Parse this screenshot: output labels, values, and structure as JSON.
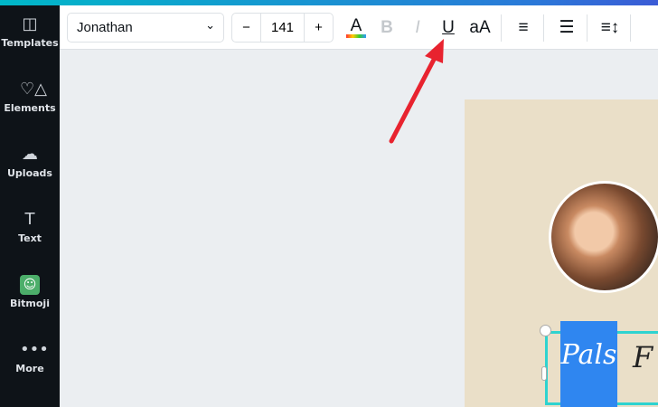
{
  "sidebar": {
    "items": [
      {
        "label": "Templates",
        "icon": "templates-icon"
      },
      {
        "label": "Elements",
        "icon": "elements-icon"
      },
      {
        "label": "Uploads",
        "icon": "upload-cloud-icon"
      },
      {
        "label": "Text",
        "icon": "text-icon"
      },
      {
        "label": "Bitmoji",
        "icon": "bitmoji-icon"
      },
      {
        "label": "More",
        "icon": "more-icon"
      }
    ]
  },
  "toolbar": {
    "font": "Jonathan",
    "size": "141",
    "decrease": "−",
    "increase": "+",
    "text_color": "A",
    "bold": "B",
    "italic": "I",
    "underline": "U",
    "case": "aA"
  },
  "canvas": {
    "text_selected": "Pals",
    "text_next": "F"
  },
  "colors": {
    "accent": "#2f86f0",
    "selection": "#2ed3d0",
    "arrow": "#e8232f"
  }
}
